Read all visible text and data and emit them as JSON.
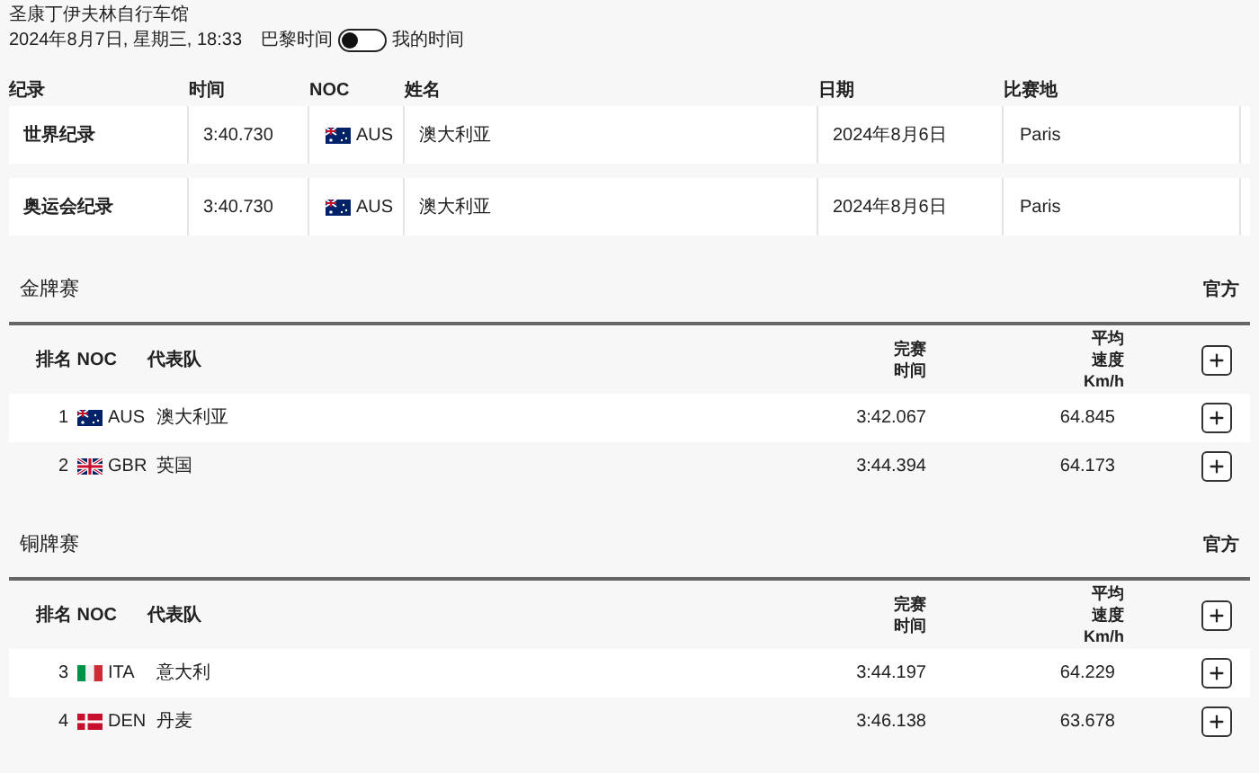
{
  "venue": "圣康丁伊夫林自行车馆",
  "datetime": "2024年8月7日, 星期三, 18:33",
  "time_toggle": {
    "left_label": "巴黎时间",
    "right_label": "我的时间",
    "on": false
  },
  "records": {
    "columns": [
      "纪录",
      "时间",
      "NOC",
      "姓名",
      "日期",
      "比赛地"
    ],
    "rows": [
      {
        "record": "世界纪录",
        "time": "3:40.730",
        "kind": "australia",
        "noc": "AUS",
        "name": "澳大利亚",
        "date": "2024年8月6日",
        "venue": "Paris"
      },
      {
        "record": "奥运会纪录",
        "time": "3:40.730",
        "kind": "australia",
        "noc": "AUS",
        "name": "澳大利亚",
        "date": "2024年8月6日",
        "venue": "Paris"
      }
    ]
  },
  "sections": [
    {
      "title": "金牌赛",
      "official": "官方",
      "header": {
        "rank_noc": "排名 NOC",
        "team": "代表队",
        "time": [
          "完赛",
          "时间"
        ],
        "speed": [
          "平均",
          "速度",
          "Km/h"
        ],
        "expanded": false
      },
      "rows": [
        {
          "rank": "1",
          "kind": "australia",
          "noc": "AUS",
          "team": "澳大利亚",
          "time": "3:42.067",
          "speed": "64.845",
          "expanded": false
        },
        {
          "rank": "2",
          "kind": "uk",
          "noc": "GBR",
          "team": "英国",
          "time": "3:44.394",
          "speed": "64.173",
          "expanded": false
        }
      ]
    },
    {
      "title": "铜牌赛",
      "official": "官方",
      "header": {
        "rank_noc": "排名 NOC",
        "team": "代表队",
        "time": [
          "完赛",
          "时间"
        ],
        "speed": [
          "平均",
          "速度",
          "Km/h"
        ],
        "expanded": false
      },
      "rows": [
        {
          "rank": "3",
          "kind": "italy",
          "noc": "ITA",
          "team": "意大利",
          "time": "3:44.197",
          "speed": "64.229",
          "expanded": false
        },
        {
          "rank": "4",
          "kind": "denmark",
          "noc": "DEN",
          "team": "丹麦",
          "time": "3:46.138",
          "speed": "63.678",
          "expanded": false
        }
      ]
    }
  ]
}
